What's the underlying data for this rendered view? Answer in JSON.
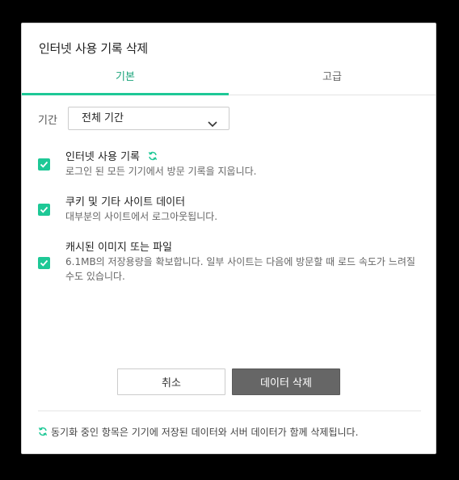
{
  "dialog": {
    "title": "인터넷 사용 기록 삭제",
    "tabs": [
      {
        "label": "기본",
        "active": true
      },
      {
        "label": "고급",
        "active": false
      }
    ],
    "period": {
      "label": "기간",
      "selected": "전체 기간"
    },
    "items": [
      {
        "title": "인터넷 사용 기록",
        "description": "로그인 된 모든 기기에서 방문 기록을 지웁니다.",
        "checked": true,
        "synced": true
      },
      {
        "title": "쿠키 및 기타 사이트 데이터",
        "description": "대부분의 사이트에서 로그아웃됩니다.",
        "checked": true,
        "synced": false
      },
      {
        "title": "캐시된 이미지 또는 파일",
        "description": "6.1MB의 저장용량을 확보합니다. 일부 사이트는 다음에 방문할 때 로드 속도가 느려질 수도 있습니다.",
        "checked": true,
        "synced": false
      }
    ],
    "buttons": {
      "cancel": "취소",
      "delete": "데이터 삭제"
    },
    "footer_note": "동기화 중인 항목은 기기에 저장된 데이터와 서버 데이터가 함께 삭제됩니다."
  },
  "colors": {
    "accent": "#1ec896",
    "delete_button": "#666666",
    "background": "#000000"
  },
  "icons": [
    "sync-icon",
    "chevron-down-icon",
    "checkmark-icon"
  ]
}
